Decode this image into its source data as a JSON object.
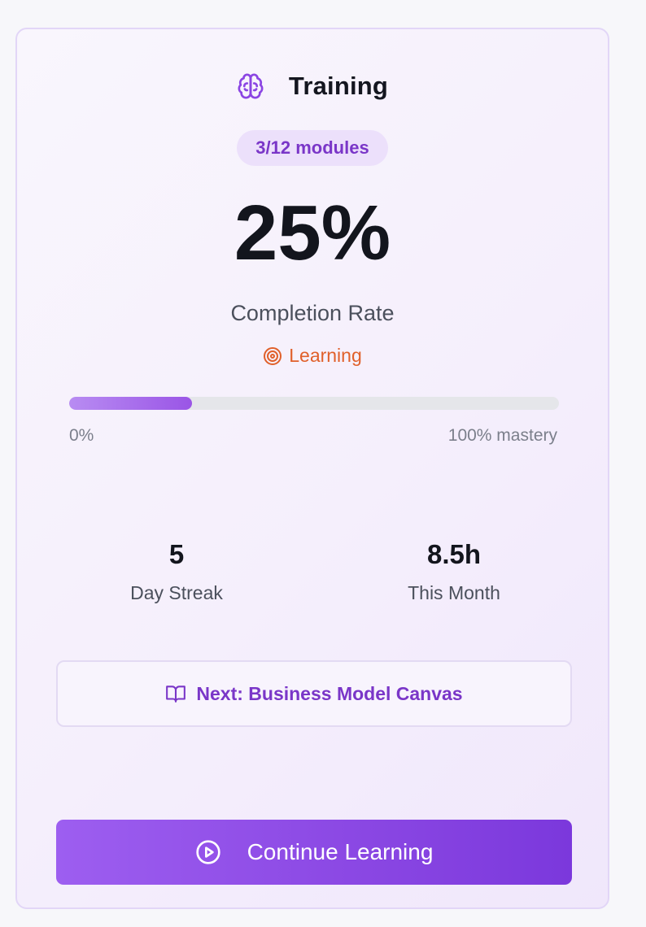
{
  "card": {
    "title": "Training",
    "title_icon": "brain-icon",
    "badge": "3/12 modules",
    "completion_value": "25%",
    "completion_label": "Completion Rate",
    "status": {
      "icon": "target-icon",
      "text": "Learning",
      "color": "#e0602a"
    },
    "progress": {
      "value": 0.25,
      "min_label": "0%",
      "max_label": "100% mastery"
    },
    "stats": [
      {
        "value": "5",
        "label": "Day Streak"
      },
      {
        "value": "8.5h",
        "label": "This Month"
      }
    ],
    "next": {
      "icon": "book-open-icon",
      "text": "Next: Business Model Canvas"
    },
    "cta": {
      "icon": "play-circle-icon",
      "label": "Continue Learning"
    }
  },
  "colors": {
    "accent": "#7a36c8",
    "button": "#8a47e3",
    "status": "#e0602a",
    "text_dark": "#13151d"
  }
}
